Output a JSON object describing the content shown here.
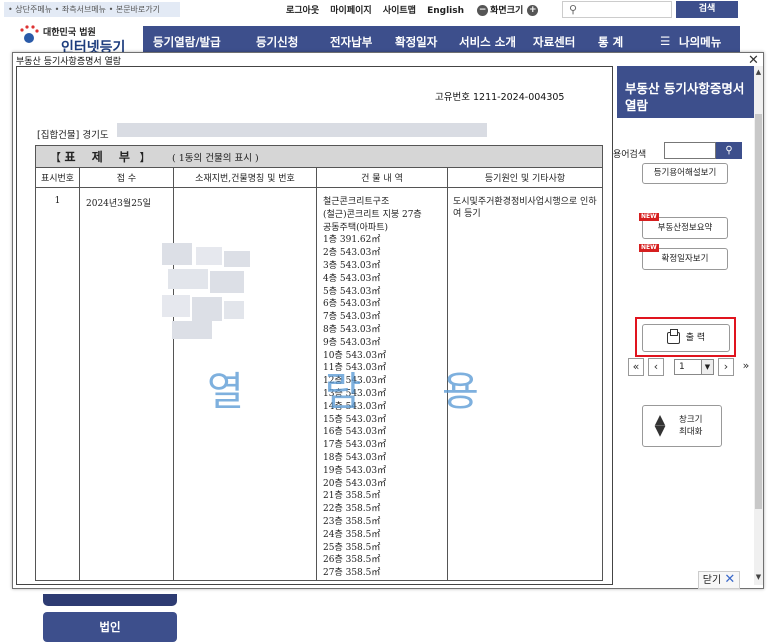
{
  "site": {
    "skip_links": "• 상단주메뉴 • 좌측서브메뉴 • 본문바로가기",
    "util_links": [
      "로그아웃",
      "마이페이지",
      "사이트맵",
      "English"
    ],
    "font_size_label": "화면크기",
    "search_button": "검색",
    "logo_court": "대한민국 법원",
    "logo_brand": "인터넷등기소",
    "nav": [
      "등기열람/발급",
      "등기신청",
      "전자납부",
      "확정일자",
      "서비스 소개",
      "자료센터",
      "통 계",
      "나의메뉴"
    ],
    "corp_button": "법인"
  },
  "modal": {
    "title": "부동산 등기사항증명서 열람",
    "unique_no": "고유번호 1211-2024-004305",
    "address": "[집합건물] 경기도",
    "section": {
      "bracket_open": "【",
      "title": "표 제 부",
      "bracket_close": "】",
      "subtitle": "( 1동의 건물의 표시 )"
    },
    "columns": [
      "표시번호",
      "접 수",
      "소재지번,건물명칭 및 번호",
      "건 물 내 역",
      "등기원인 및 기타사항"
    ],
    "row": {
      "num": "1",
      "date": "2024년3월25일",
      "building": [
        "철근콘크리트구조",
        "(철근)콘크리트 지붕 27층",
        "공동주택(아파트)",
        "1층 391.62㎡",
        "2층 543.03㎡",
        "3층 543.03㎡",
        "4층 543.03㎡",
        "5층 543.03㎡",
        "6층 543.03㎡",
        "7층 543.03㎡",
        "8층 543.03㎡",
        "9층 543.03㎡",
        "10층 543.03㎡",
        "11층 543.03㎡",
        "12층 543.03㎡",
        "13층 543.03㎡",
        "14층 543.03㎡",
        "15층 543.03㎡",
        "16층 543.03㎡",
        "17층 543.03㎡",
        "18층 543.03㎡",
        "19층 543.03㎡",
        "20층 543.03㎡",
        "21층 358.5㎡",
        "22층 358.5㎡",
        "23층 358.5㎡",
        "24층 358.5㎡",
        "25층 358.5㎡",
        "26층 358.5㎡",
        "27층 358.5㎡"
      ],
      "cause": "도시및주거환경정비사업시행으로 인하여 등기"
    },
    "watermark": "열 람 용"
  },
  "panel": {
    "title": "부동산 등기사항증명서 열람",
    "term_label": "용어검색",
    "term_button": "🔍",
    "term_explain": "등기용어해설보기",
    "summary": "부동산정보요약",
    "confirm": "확정일자보기",
    "new_badge": "NEW",
    "print": "출 력",
    "page_value": "1",
    "maximize_line1": "창크기",
    "maximize_line2": "최대화",
    "close": "닫기"
  }
}
